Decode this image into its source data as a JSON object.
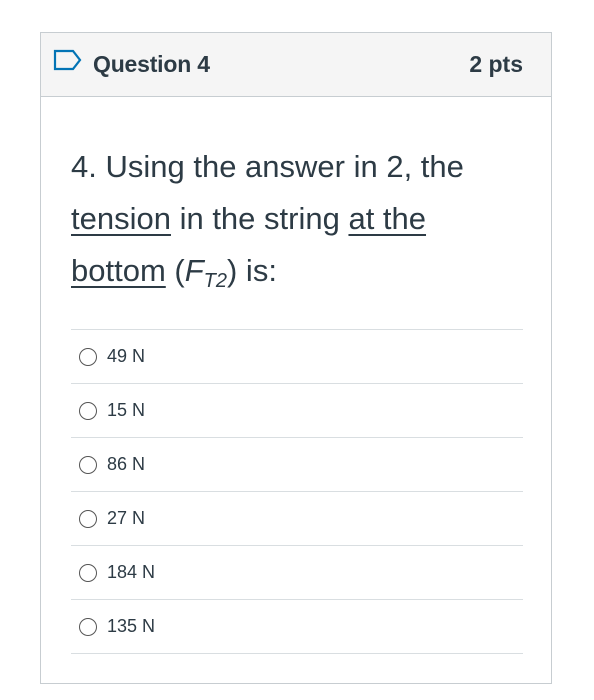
{
  "question": {
    "title": "Question 4",
    "points": "2 pts",
    "text_part1": "4. Using the answer in 2, the",
    "text_underlined1": "tension",
    "text_part2": " in the string ",
    "text_underlined2": "at the",
    "text_underlined3": "bottom",
    "text_part3": " (",
    "math_var": "F",
    "math_sub": "T2",
    "text_part4": ") is:"
  },
  "answers": [
    {
      "label": "49 N",
      "selected": false
    },
    {
      "label": "15 N",
      "selected": false
    },
    {
      "label": "86 N",
      "selected": false
    },
    {
      "label": "27 N",
      "selected": false
    },
    {
      "label": "184 N",
      "selected": false
    },
    {
      "label": "135 N",
      "selected": false
    }
  ],
  "icons": {
    "flag": "flag-question-icon"
  },
  "colors": {
    "header_bg": "#f5f5f5",
    "border": "#c7cdd1",
    "flag": "#0374b5",
    "text": "#2d3b45"
  }
}
